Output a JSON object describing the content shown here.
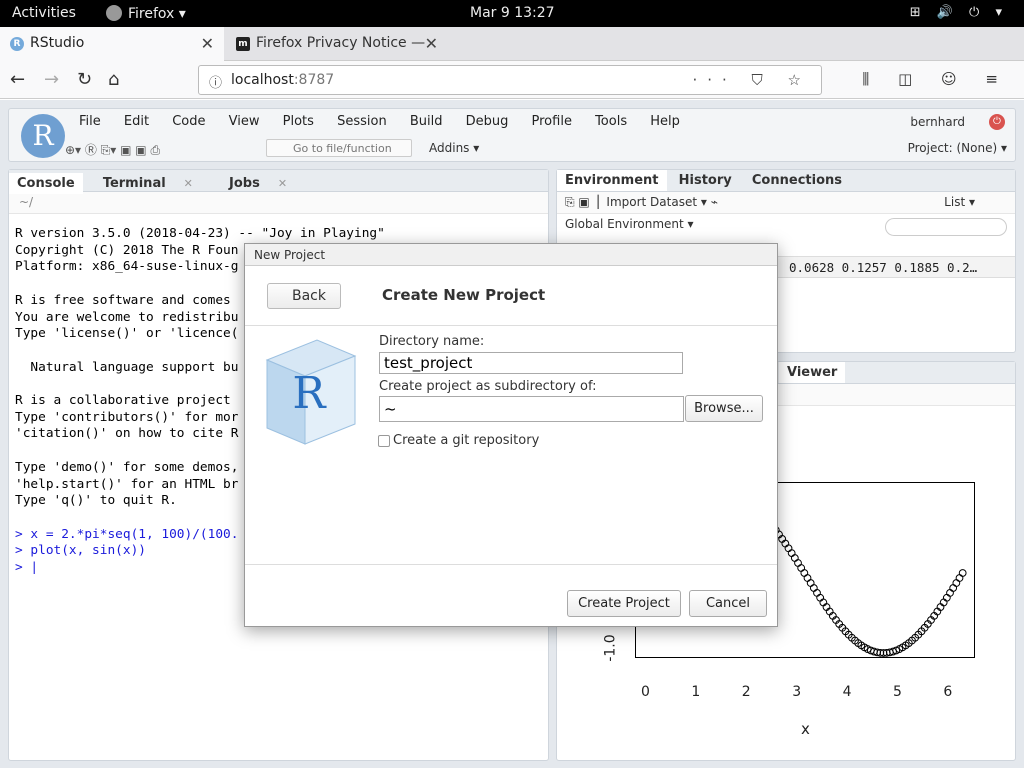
{
  "gnome": {
    "activities": "Activities",
    "app": "Firefox ▾",
    "clock": "Mar 9  13:27",
    "tray": "⊞ 🔊 ⏻ ▾"
  },
  "browser": {
    "tabs": [
      {
        "title": "RStudio",
        "icon": "R"
      },
      {
        "title": "Firefox Privacy Notice —",
        "icon": "m"
      }
    ],
    "url_host": "localhost",
    "url_port": ":8787",
    "url_actions": "··· ⛉ ☆",
    "right_tools": "⫼ ◫ ☺ ≡"
  },
  "rstudio": {
    "logo": "R",
    "menu": [
      "File",
      "Edit",
      "Code",
      "View",
      "Plots",
      "Session",
      "Build",
      "Debug",
      "Profile",
      "Tools",
      "Help"
    ],
    "user": "bernhard",
    "goto_placeholder": "Go to file/function",
    "addins": "Addins ▾",
    "project": "Project: (None) ▾",
    "left_tabs": [
      "Console",
      "Terminal",
      "Jobs"
    ],
    "console_path": "~/",
    "console_lines": [
      "R version 3.5.0 (2018-04-23) -- \"Joy in Playing\"",
      "Copyright (C) 2018 The R Foun",
      "Platform: x86_64-suse-linux-g",
      "",
      "R is free software and comes ",
      "You are welcome to redistribu",
      "Type 'license()' or 'licence(",
      "",
      "  Natural language support bu",
      "",
      "R is a collaborative project ",
      "Type 'contributors()' for mor",
      "'citation()' on how to cite R",
      "",
      "Type 'demo()' for some demos,",
      "'help.start()' for an HTML br",
      "Type 'q()' to quit R."
    ],
    "console_cmds": [
      "> x = 2.*pi*seq(1, 100)/(100.",
      "> plot(x, sin(x))",
      "> |"
    ],
    "env_tabs": [
      "Environment",
      "History",
      "Connections"
    ],
    "import_dataset": "Import Dataset ▾",
    "list_view": "List ▾",
    "global_env": "Global Environment ▾",
    "env_values": "0.0628 0.1257 0.1885 0.2…",
    "viewer_tab": "Viewer"
  },
  "plot": {
    "x_ticks": [
      "0",
      "1",
      "2",
      "3",
      "4",
      "5",
      "6"
    ],
    "y_tick": "-1.0",
    "xlabel": "x"
  },
  "chart_data": {
    "type": "scatter",
    "title": "",
    "xlabel": "x",
    "ylabel": "",
    "xlim": [
      0,
      6.3
    ],
    "ylim": [
      -1,
      1
    ],
    "series": [
      {
        "x_expr": "2*pi*seq(1,100)/100",
        "y_expr": "sin(x)"
      }
    ]
  },
  "dialog": {
    "title": "New Project",
    "back": "Back",
    "heading": "Create New Project",
    "dir_label": "Directory name:",
    "dir_value": "test_project",
    "sub_label": "Create project as subdirectory of:",
    "sub_value": "~",
    "browse": "Browse...",
    "git_label": "Create a git repository",
    "create": "Create Project",
    "cancel": "Cancel",
    "cube_letter": "R"
  }
}
